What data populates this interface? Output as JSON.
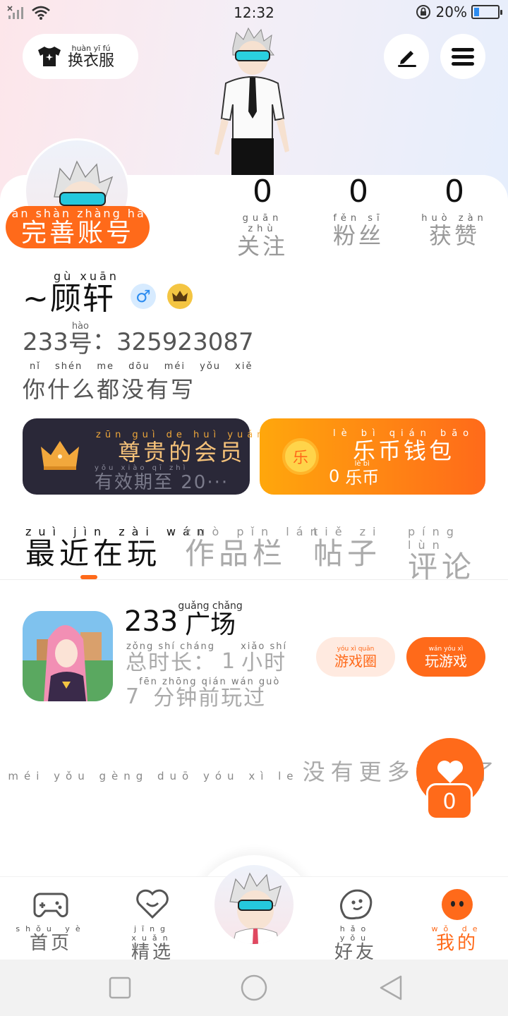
{
  "status_bar": {
    "time": "12:32",
    "battery": "20%",
    "battery_level": 0.2
  },
  "top": {
    "outfit": {
      "pinyin": "huàn yī fú",
      "label": "换衣服"
    }
  },
  "profile": {
    "complete_account": {
      "pinyin": "wán shàn zhàng hào",
      "label": "完善账号"
    },
    "stats": [
      {
        "value": "0",
        "pinyin": "guān zhù",
        "label": "关注"
      },
      {
        "value": "0",
        "pinyin": "fěn sī",
        "label": "粉丝"
      },
      {
        "value": "0",
        "pinyin": "huò zàn",
        "label": "获赞"
      }
    ],
    "name": {
      "pinyin": "gù xuān",
      "label": "~顾轩"
    },
    "gender_symbol": "♂",
    "uid": {
      "prefix": "233",
      "hao_pinyin": "hào",
      "hao": "号",
      "sep": "：",
      "number": "325923087"
    },
    "bio": {
      "pinyin": "nǐ shén me dōu méi yǒu xiě",
      "label": "你什么都没有写"
    }
  },
  "vip": {
    "pinyin": "zūn guì de huì yuán",
    "label": "尊贵的会员",
    "sub_pinyin": "yǒu xiào qī zhì",
    "sub_label": "有效期至 20···"
  },
  "wallet": {
    "pinyin": "lè bì qián bāo",
    "label": "乐币钱包",
    "amount": "0",
    "unit_pinyin": "lè bì",
    "unit": "乐币",
    "coin_glyph": "乐"
  },
  "tabs": [
    {
      "pinyin": "zuì jìn zài wán",
      "label": "最近在玩",
      "active": true
    },
    {
      "pinyin": "zuò pǐn lán",
      "label": "作品栏",
      "active": false
    },
    {
      "pinyin": "tiě zi",
      "label": "帖子",
      "active": false
    },
    {
      "pinyin": "píng lùn",
      "label": "评论",
      "active": false
    }
  ],
  "game": {
    "name_num": "233",
    "name_pinyin": "guǎng chǎng",
    "name": "广场",
    "duration_pinyin": "zǒng shí cháng",
    "duration_label": "总时长：",
    "duration_value": "1",
    "hour_pinyin": "xiǎo shí",
    "hour": "小时",
    "last_num": "7",
    "last_pinyin": "fēn zhōng qián wán guò",
    "last_label": "分钟前玩过",
    "circle_btn": {
      "pinyin": "yóu xì quān",
      "label": "游戏圈"
    },
    "play_btn": {
      "pinyin": "wán yóu xì",
      "label": "玩游戏"
    }
  },
  "no_more": {
    "pinyin": "méi yǒu gèng duō yóu xì le",
    "label": "没有更多游戏了"
  },
  "like_count": "0",
  "bottom_nav": [
    {
      "pinyin": "shǒu yè",
      "label": "首页",
      "icon": "gamepad-icon",
      "active": false
    },
    {
      "pinyin": "jīng xuǎn",
      "label": "精选",
      "icon": "heart-smile-icon",
      "active": false
    },
    {
      "pinyin": "hǎo yǒu",
      "label": "好友",
      "icon": "friend-blob-icon",
      "active": false
    },
    {
      "pinyin": "wǒ de",
      "label": "我的",
      "icon": "me-face-icon",
      "active": true
    }
  ],
  "colors": {
    "accent": "#ff6a1a",
    "vip_bg": "#2a2838",
    "vip_text": "#f5c27a"
  }
}
